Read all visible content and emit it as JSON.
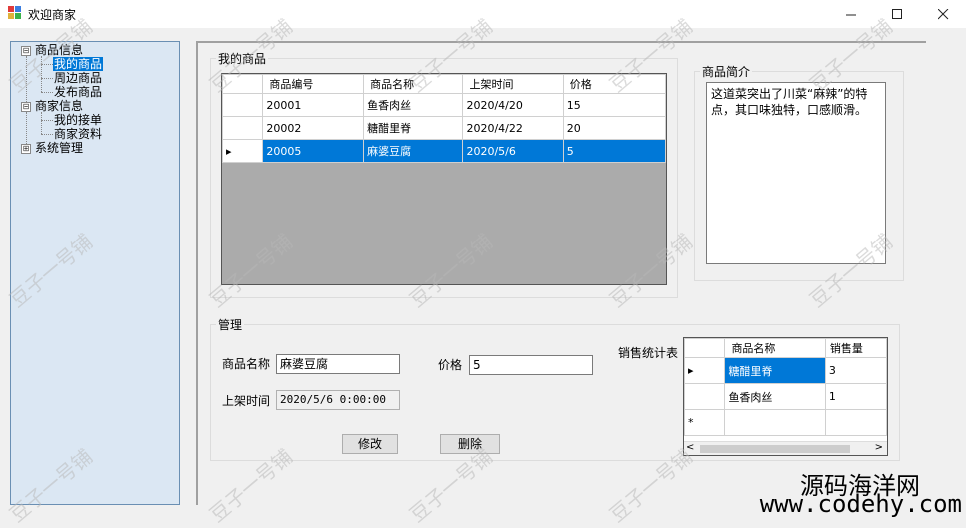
{
  "window": {
    "title": "欢迎商家"
  },
  "tree": {
    "nodes": [
      {
        "label": "商品信息",
        "toggle": "⊟"
      },
      {
        "label": "我的商品"
      },
      {
        "label": "周边商品"
      },
      {
        "label": "发布商品"
      },
      {
        "label": "商家信息",
        "toggle": "⊟"
      },
      {
        "label": "我的接单"
      },
      {
        "label": "商家资料"
      },
      {
        "label": "系统管理",
        "toggle": "⊞"
      }
    ]
  },
  "products": {
    "group_label": "我的商品",
    "columns": [
      "商品编号",
      "商品名称",
      "上架时间",
      "价格"
    ],
    "rows": [
      [
        "20001",
        "鱼香肉丝",
        "2020/4/20",
        "15"
      ],
      [
        "20002",
        "糖醋里脊",
        "2020/4/22",
        "20"
      ],
      [
        "20005",
        "麻婆豆腐",
        "2020/5/6",
        "5"
      ]
    ],
    "current_marker": "▸"
  },
  "intro": {
    "group_label": "商品简介",
    "text": "这道菜突出了川菜“麻辣”的特点，其口味独特，口感顺滑。"
  },
  "manage": {
    "group_label": "管理",
    "name_label": "商品名称",
    "name_value": "麻婆豆腐",
    "price_label": "价格",
    "price_value": "5",
    "time_label": "上架时间",
    "time_value": "2020/5/6 0:00:00",
    "edit_button": "修改",
    "delete_button": "删除"
  },
  "sales": {
    "label": "销售统计表",
    "columns": [
      "商品名称",
      "销售量"
    ],
    "rows": [
      [
        "糖醋里脊",
        "3"
      ],
      [
        "鱼香肉丝",
        "1"
      ]
    ],
    "current_marker": "▸",
    "new_row_marker": "*",
    "scroll_left": "<",
    "scroll_right": ">"
  },
  "watermark": {
    "text": "豆子一号铺"
  },
  "branding": {
    "line1": "源码海洋网",
    "line2": "www.codehy.com"
  }
}
